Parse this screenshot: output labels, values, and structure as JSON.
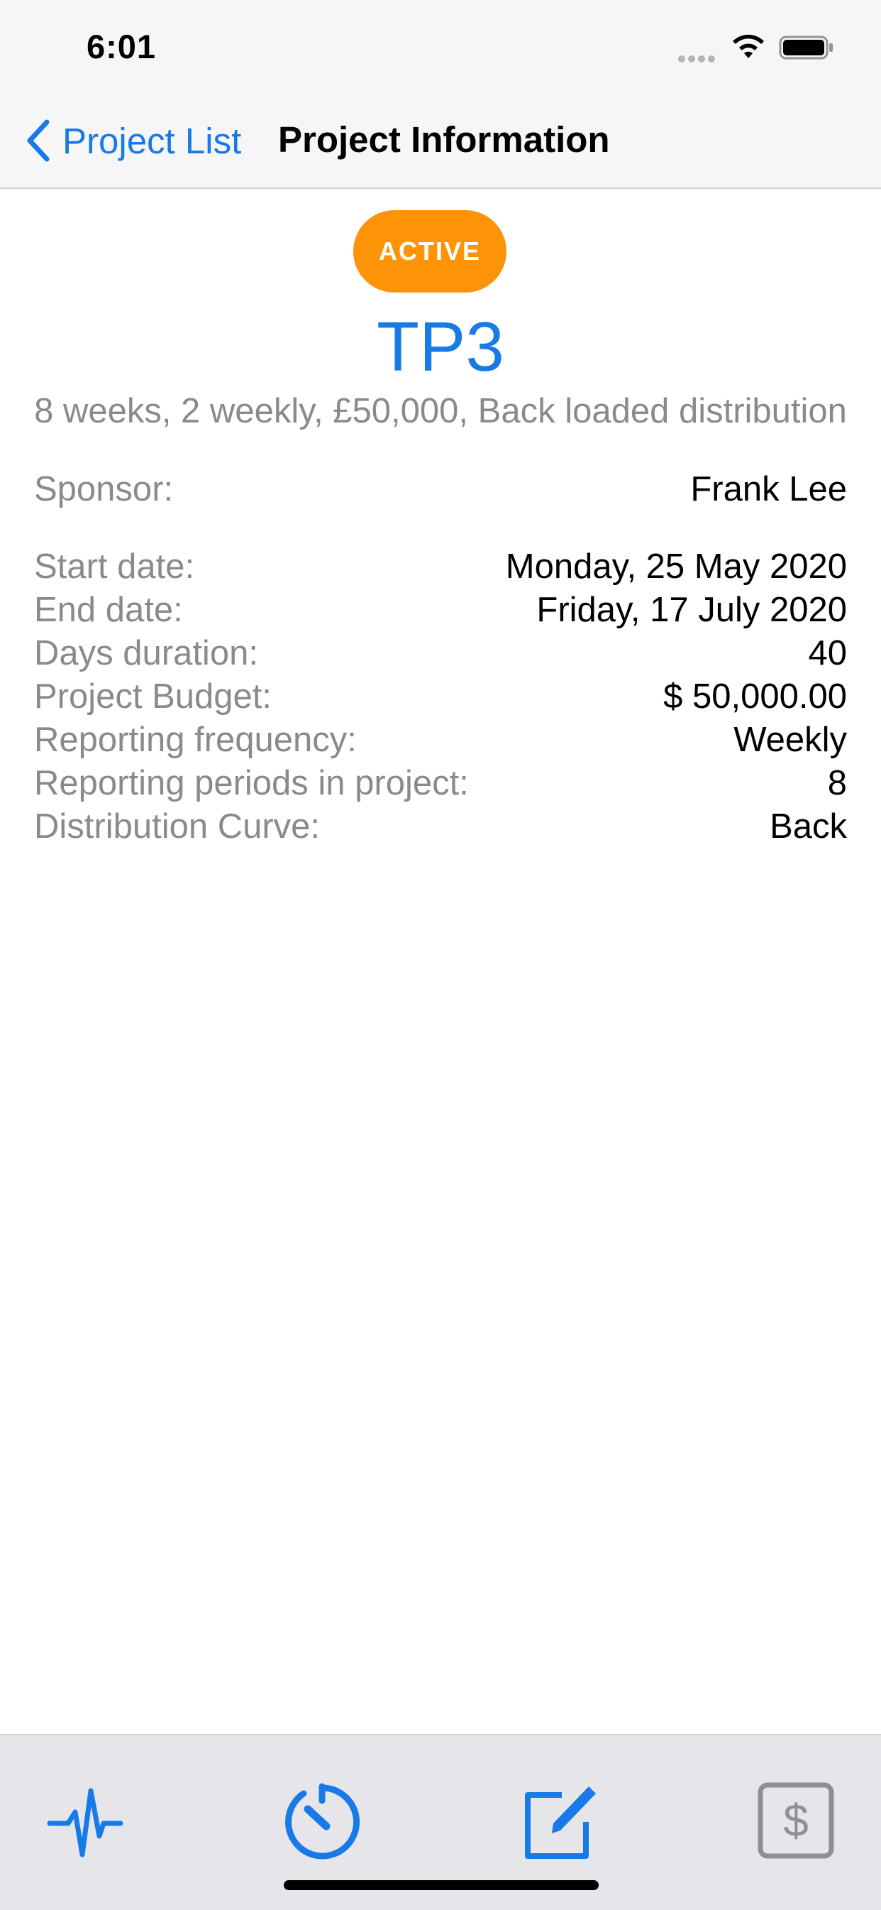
{
  "status_bar": {
    "time": "6:01"
  },
  "nav": {
    "back_label": "Project List",
    "title": "Project Information"
  },
  "project": {
    "status": "ACTIVE",
    "name": "TP3",
    "summary": "8 weeks, 2 weekly, £50,000, Back loaded distribution"
  },
  "details": {
    "sponsor": {
      "label": "Sponsor:",
      "value": "Frank Lee"
    },
    "start_date": {
      "label": "Start date:",
      "value": "Monday, 25 May 2020"
    },
    "end_date": {
      "label": "End date:",
      "value": "Friday, 17 July 2020"
    },
    "days_duration": {
      "label": "Days duration:",
      "value": "40"
    },
    "budget": {
      "label": "Project Budget:",
      "value": "$ 50,000.00"
    },
    "frequency": {
      "label": "Reporting frequency:",
      "value": "Weekly"
    },
    "periods": {
      "label": "Reporting periods in project:",
      "value": "8"
    },
    "curve": {
      "label": "Distribution Curve:",
      "value": "Back"
    }
  },
  "tab_bar": {
    "items": [
      {
        "icon": "waveform-icon"
      },
      {
        "icon": "timer-icon"
      },
      {
        "icon": "edit-icon"
      },
      {
        "icon": "dollar-icon"
      }
    ]
  },
  "colors": {
    "accent": "#177ae6",
    "badge": "#fd9408",
    "secondary_text": "#8a8a8e",
    "disabled_icon": "#8e8e93"
  }
}
